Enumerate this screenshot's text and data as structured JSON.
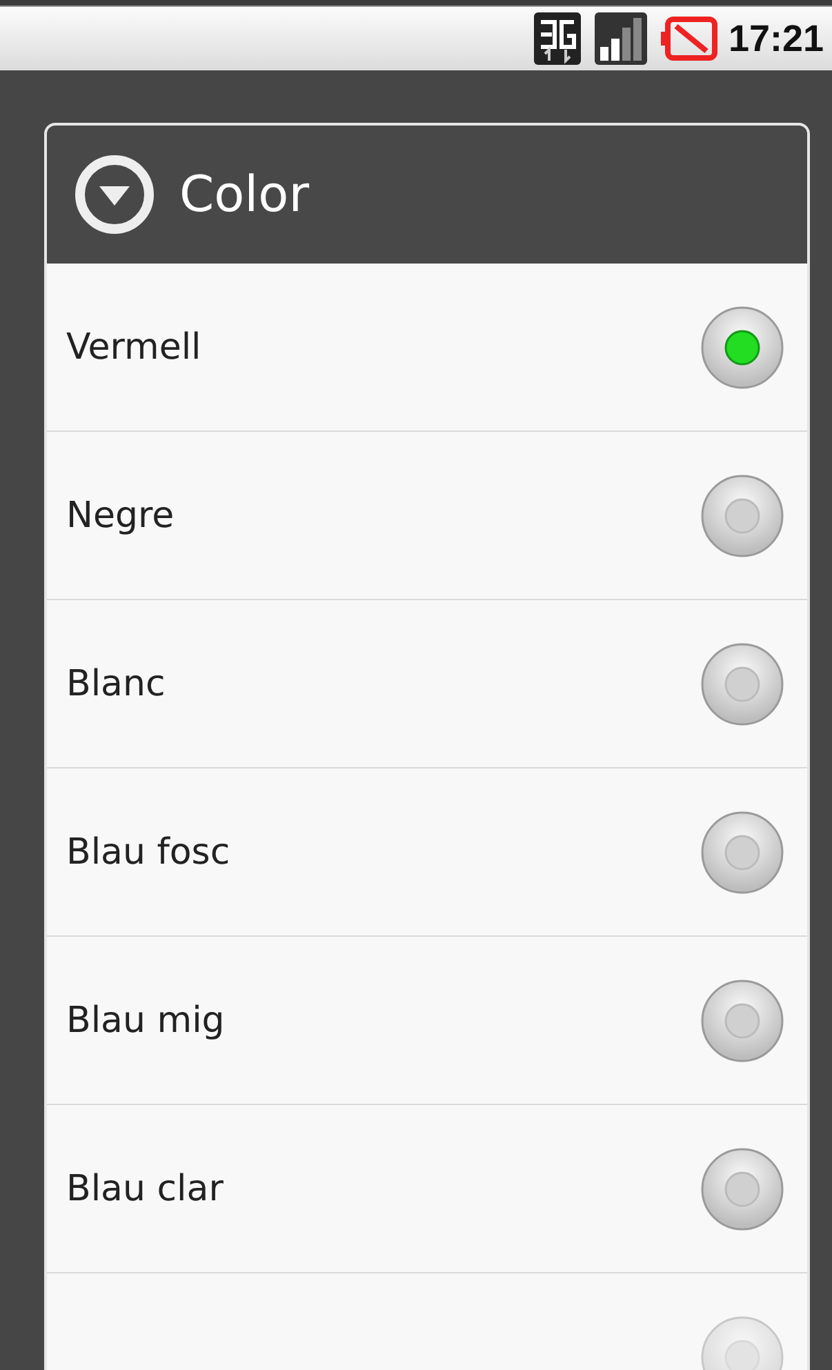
{
  "status_bar": {
    "time": "17:21"
  },
  "dialog": {
    "title": "Color",
    "options": [
      {
        "label": "Vermell",
        "selected": true
      },
      {
        "label": "Negre",
        "selected": false
      },
      {
        "label": "Blanc",
        "selected": false
      },
      {
        "label": "Blau fosc",
        "selected": false
      },
      {
        "label": "Blau mig",
        "selected": false
      },
      {
        "label": "Blau clar",
        "selected": false
      },
      {
        "selected": false
      }
    ]
  }
}
